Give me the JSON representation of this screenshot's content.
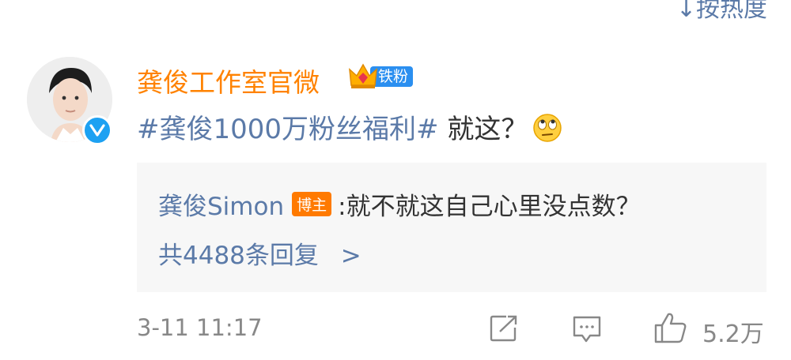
{
  "sort_label": "↓按热度",
  "post": {
    "username": "龚俊工作室官微",
    "fan_badge": "铁粉",
    "hashtag": "#龚俊1000万粉丝福利#",
    "comment_text": " 就这？",
    "emoji_icon": "eye-roll-emoji-icon"
  },
  "reply": {
    "author": "龚俊Simon",
    "author_badge": "博主",
    "text": ":就不就这自己心里没点数？",
    "reply_count": "共4488条回复",
    "chevron": ">"
  },
  "footer": {
    "timestamp": "3-11 11:17",
    "like_count": "5.2万"
  },
  "colors": {
    "username": "#ff8200",
    "link": "#5b7aa8",
    "verified": "#1da1f2",
    "badge_blue": "#2b8ff0",
    "badge_orange": "#ff7a00"
  }
}
